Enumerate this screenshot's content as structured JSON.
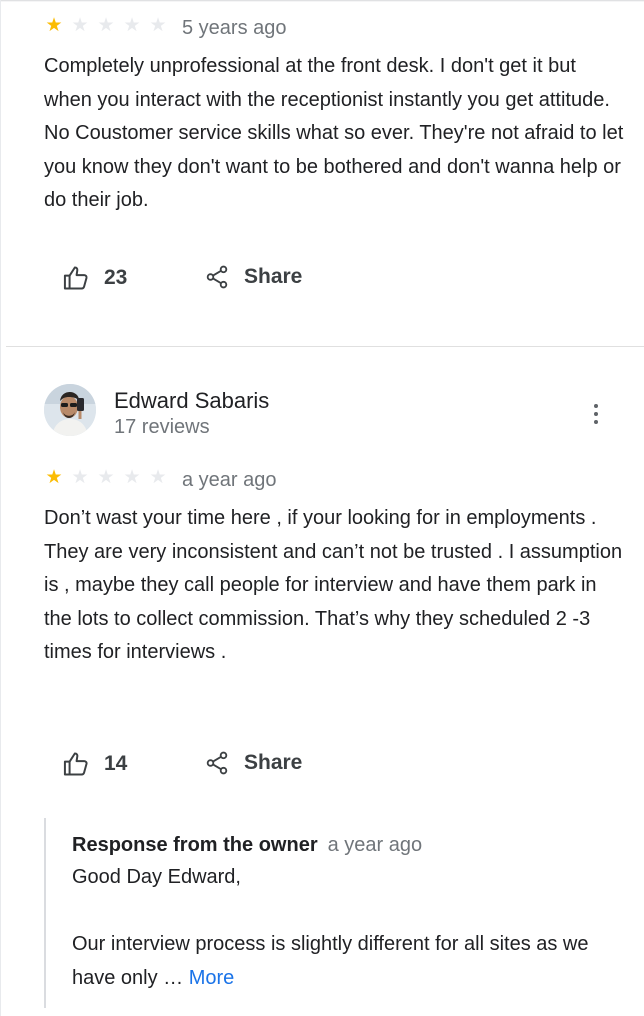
{
  "review1": {
    "rating": 1,
    "max_rating": 5,
    "date": "5 years ago",
    "text": "Completely unprofessional at the front desk. I don't get it but when you interact with the receptionist instantly you get attitude. No Coustomer service skills what so ever. They're not afraid to let you know they don't want to be bothered and don't wanna help or do their job.",
    "likes": "23",
    "share_label": "Share"
  },
  "review2": {
    "reviewer_name": "Edward Sabaris",
    "reviewer_meta": "17 reviews",
    "rating": 1,
    "max_rating": 5,
    "date": "a year ago",
    "text": "Don’t wast your time here , if your looking for in employments . They are very inconsistent and can’t not be trusted . I assumption is , maybe they call people for interview and have them park in the lots to collect commission. That’s why they scheduled 2 -3 times for interviews .",
    "likes": "14",
    "share_label": "Share",
    "owner_response": {
      "label": "Response from the owner",
      "date": "a year ago",
      "text": "Good Day Edward,\n\nOur interview process is slightly different for all sites as we have only … ",
      "more_label": "More"
    }
  },
  "colors": {
    "star_filled": "#fbbc04",
    "star_empty": "#e8eaed",
    "link": "#1a73e8",
    "secondary_text": "#70757a"
  },
  "icons": [
    "thumbs-up-icon",
    "share-icon",
    "more-vert-icon",
    "star-icon"
  ]
}
